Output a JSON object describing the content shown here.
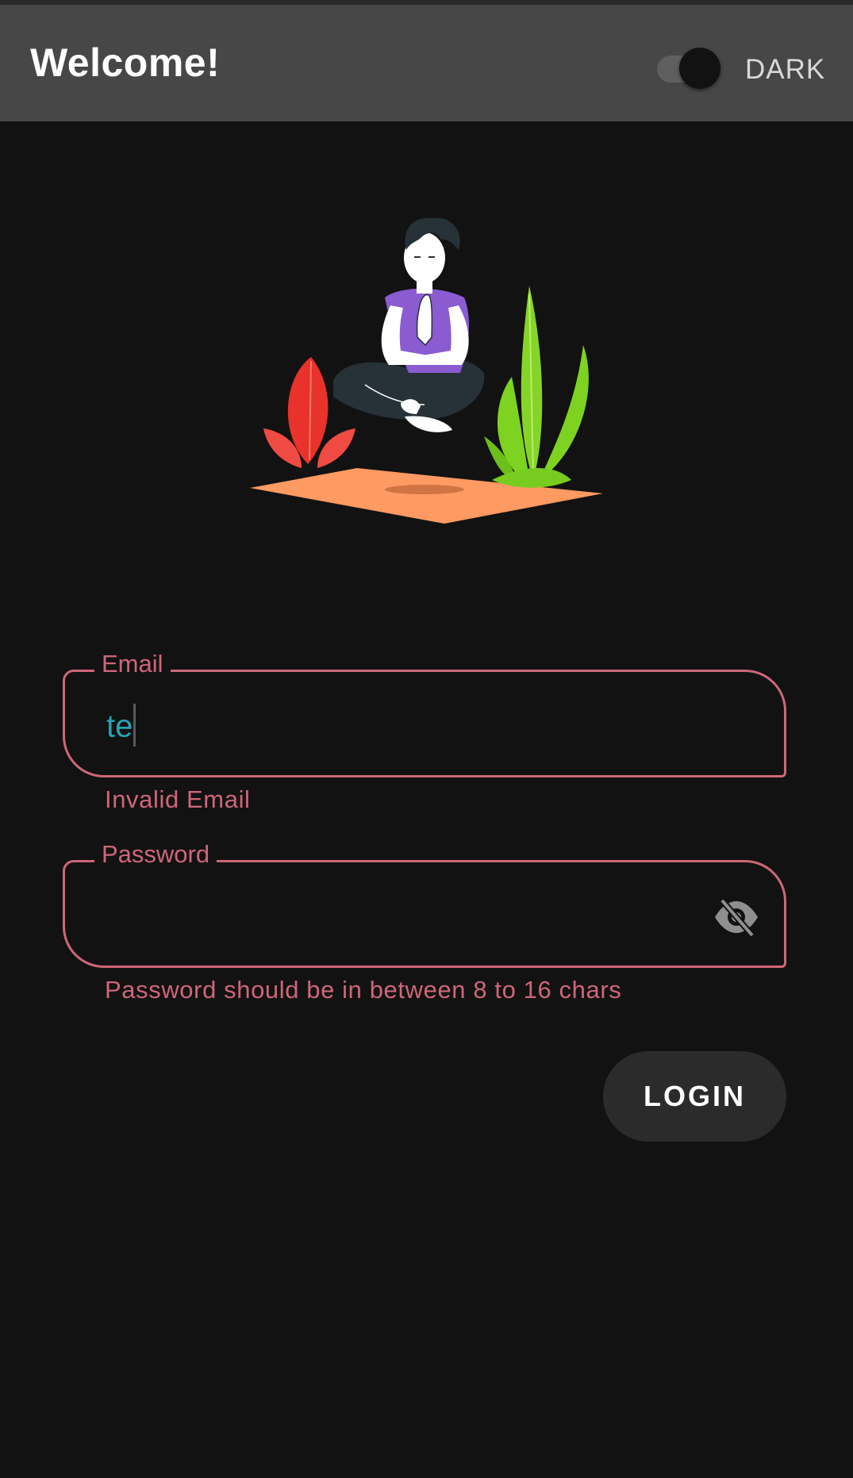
{
  "app_bar": {
    "title": "Welcome!",
    "theme_toggle": {
      "label": "DARK",
      "on": true
    }
  },
  "illustration": {
    "icon": "meditation-illustration"
  },
  "form": {
    "email": {
      "label": "Email",
      "value": "te",
      "error": "Invalid Email"
    },
    "password": {
      "label": "Password",
      "value": "",
      "error": "Password should be in between 8 to 16 chars",
      "visibility_icon": "eye-off-icon"
    },
    "login_label": "LOGIN"
  },
  "colors": {
    "background": "#121212",
    "app_bar": "#474747",
    "error": "#cf6679",
    "input_text": "#26a2b5",
    "button": "#2b2b2b"
  }
}
